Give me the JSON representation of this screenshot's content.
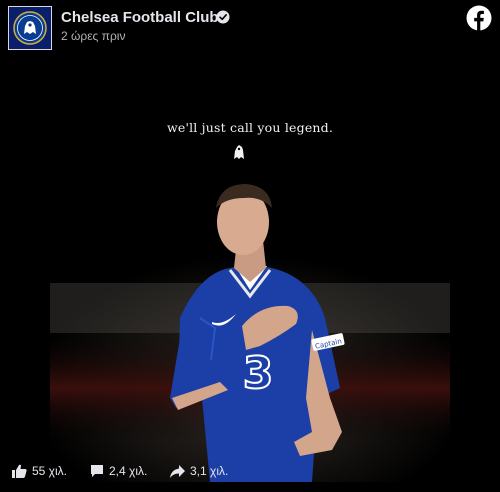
{
  "post": {
    "page_name": "Chelsea Football Club",
    "verified": true,
    "time": "2 ώρες πριν"
  },
  "media": {
    "tagline": "we'll just call you legend.",
    "shirt_sponsor": "3",
    "armband_text": "Captain",
    "colors": {
      "kit_blue": "#1b3fa6",
      "background": "#000000"
    }
  },
  "actions": {
    "likes": "55 χιλ.",
    "comments": "2,4 χιλ.",
    "shares": "3,1 χιλ."
  },
  "icons": [
    "chelsea-crest-icon",
    "verified-badge-icon",
    "facebook-logo-icon",
    "like-icon",
    "comment-icon",
    "share-icon"
  ]
}
